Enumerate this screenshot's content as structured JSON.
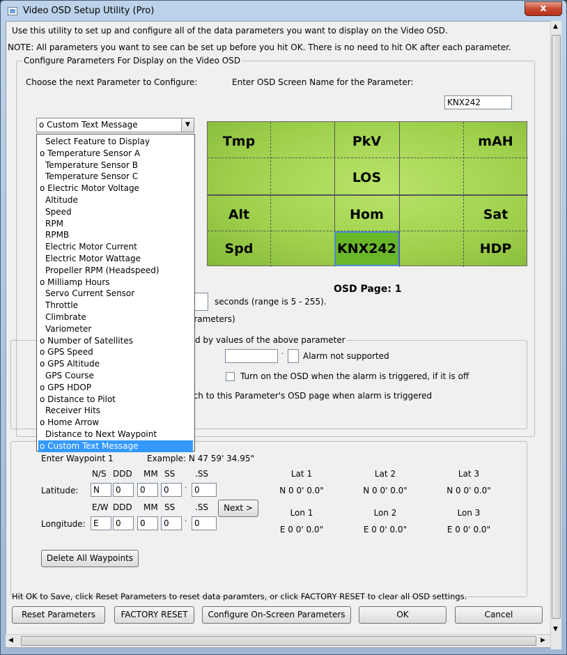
{
  "window": {
    "title": "Video OSD Setup Utility (Pro)",
    "close_label": "x"
  },
  "intro": {
    "line1": "Use this utility to set up and configure all of the data parameters you want to display on the Video OSD.",
    "line2": "NOTE:  All parameters you want to see can be set up before you hit OK. There is no need to hit OK after each parameter."
  },
  "config_group": {
    "title": "Configure Parameters For Display on the Video OSD",
    "choose_label": "Choose the next Parameter to Configure:",
    "screen_name_label": "Enter OSD Screen Name for the Parameter:",
    "screen_name_value": "KNX242"
  },
  "dropdown": {
    "selected": "o Custom Text Message",
    "options": [
      "Select Feature to Display",
      "o Temperature Sensor A",
      "Temperature Sensor B",
      "Temperature Sensor C",
      "o Electric Motor Voltage",
      "Altitude",
      "Speed",
      "RPM",
      "RPMB",
      "Electric Motor Current",
      "Electric Motor Wattage",
      "Propeller RPM (Headspeed)",
      "o Milliamp Hours",
      "Servo Current Sensor",
      "Throttle",
      "Climbrate",
      "Variometer",
      "o Number of Satellites",
      "o GPS Speed",
      "o GPS Altitude",
      "GPS Course",
      "o GPS HDOP",
      "o Distance to Pilot",
      "Receiver Hits",
      "o Home Arrow",
      "Distance to Next Waypoint",
      "o Custom Text Message"
    ],
    "selected_index": 26
  },
  "osd_grid": {
    "cells": [
      "Tmp",
      "PkV",
      "mAH",
      "LOS",
      "Alt",
      "Hom",
      "Sat",
      "Spd",
      "KNX242",
      "HDP"
    ],
    "page_label": "OSD Page: 1",
    "bg_color": "#a8d858"
  },
  "timing": {
    "seconds_label": "seconds (range is 5 - 255).",
    "params_label": "arameters)"
  },
  "alarm_group": {
    "title_fragment": "d by values of the above parameter",
    "alarm_status": "Alarm not supported",
    "turn_on_label": "Turn on the OSD when the alarm is triggered, if it is off",
    "switch_label": "tch to this Parameter's OSD page when alarm is triggered"
  },
  "waypoints": {
    "enter_label": "Enter Waypoint 1",
    "example_label": "Example: N 47 59' 34.95\"",
    "lat_headers": [
      "N/S",
      "DDD",
      "MM",
      "SS",
      ".SS"
    ],
    "lon_headers": [
      "E/W",
      "DDD",
      "MM",
      "SS",
      ".SS"
    ],
    "latitude_label": "Latitude:",
    "longitude_label": "Longitude:",
    "lat_values": [
      "N",
      "0",
      "0",
      "0",
      "0"
    ],
    "lon_values": [
      "E",
      "0",
      "0",
      "0",
      "0"
    ],
    "next_label": "Next >",
    "delete_label": "Delete All Waypoints",
    "lat_cols": [
      {
        "label": "Lat 1",
        "value": "N 0 0' 0.0\""
      },
      {
        "label": "Lat 2",
        "value": "N 0 0' 0.0\""
      },
      {
        "label": "Lat 3",
        "value": "N 0 0' 0.0\""
      }
    ],
    "lon_cols": [
      {
        "label": "Lon 1",
        "value": "E 0 0' 0.0\""
      },
      {
        "label": "Lon 2",
        "value": "E 0 0' 0.0\""
      },
      {
        "label": "Lon 3",
        "value": "E 0 0' 0.0\""
      }
    ]
  },
  "footer": {
    "hint": "Hit OK to Save, click Reset Parameters to reset data paramters, or click FACTORY RESET to clear all OSD settings.",
    "reset_label": "Reset Parameters",
    "factory_label": "FACTORY RESET",
    "configure_label": "Configure On-Screen Parameters",
    "ok_label": "OK",
    "cancel_label": "Cancel"
  }
}
